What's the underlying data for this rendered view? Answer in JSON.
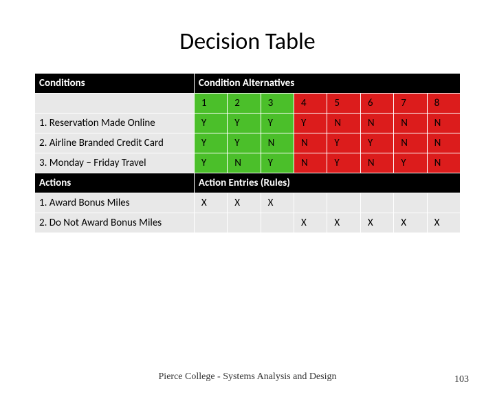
{
  "title": "Decision Table",
  "headers": {
    "conditions": "Conditions",
    "cond_alt": "Condition Alternatives",
    "actions": "Actions",
    "action_entries": "Action Entries (Rules)"
  },
  "cols": [
    "1",
    "2",
    "3",
    "4",
    "5",
    "6",
    "7",
    "8"
  ],
  "conditions": [
    {
      "label": "1.  Reservation Made Online",
      "vals": [
        "Y",
        "Y",
        "Y",
        "Y",
        "N",
        "N",
        "N",
        "N"
      ]
    },
    {
      "label": "2.  Airline Branded Credit Card",
      "vals": [
        "Y",
        "Y",
        "N",
        "N",
        "Y",
        "Y",
        "N",
        "N"
      ]
    },
    {
      "label": "3.  Monday – Friday Travel",
      "vals": [
        "Y",
        "N",
        "Y",
        "N",
        "Y",
        "N",
        "Y",
        "N"
      ]
    }
  ],
  "actions": [
    {
      "label": "1.   Award Bonus Miles",
      "marks": [
        "X",
        "X",
        "X",
        "",
        "",
        "",
        "",
        ""
      ]
    },
    {
      "label": "2.   Do Not Award Bonus Miles",
      "marks": [
        "",
        "",
        "",
        "X",
        "X",
        "X",
        "X",
        "X"
      ]
    }
  ],
  "footer": "Pierce College - Systems Analysis and Design",
  "page": "103",
  "chart_data": {
    "type": "table",
    "title": "Decision Table",
    "columns": [
      "1",
      "2",
      "3",
      "4",
      "5",
      "6",
      "7",
      "8"
    ],
    "conditions": {
      "Reservation Made Online": [
        "Y",
        "Y",
        "Y",
        "Y",
        "N",
        "N",
        "N",
        "N"
      ],
      "Airline Branded Credit Card": [
        "Y",
        "Y",
        "N",
        "N",
        "Y",
        "Y",
        "N",
        "N"
      ],
      "Monday – Friday Travel": [
        "Y",
        "N",
        "Y",
        "N",
        "Y",
        "N",
        "Y",
        "N"
      ]
    },
    "actions": {
      "Award Bonus Miles": [
        "X",
        "X",
        "X",
        "",
        "",
        "",
        "",
        ""
      ],
      "Do Not Award Bonus Miles": [
        "",
        "",
        "",
        "X",
        "X",
        "X",
        "X",
        "X"
      ]
    }
  }
}
